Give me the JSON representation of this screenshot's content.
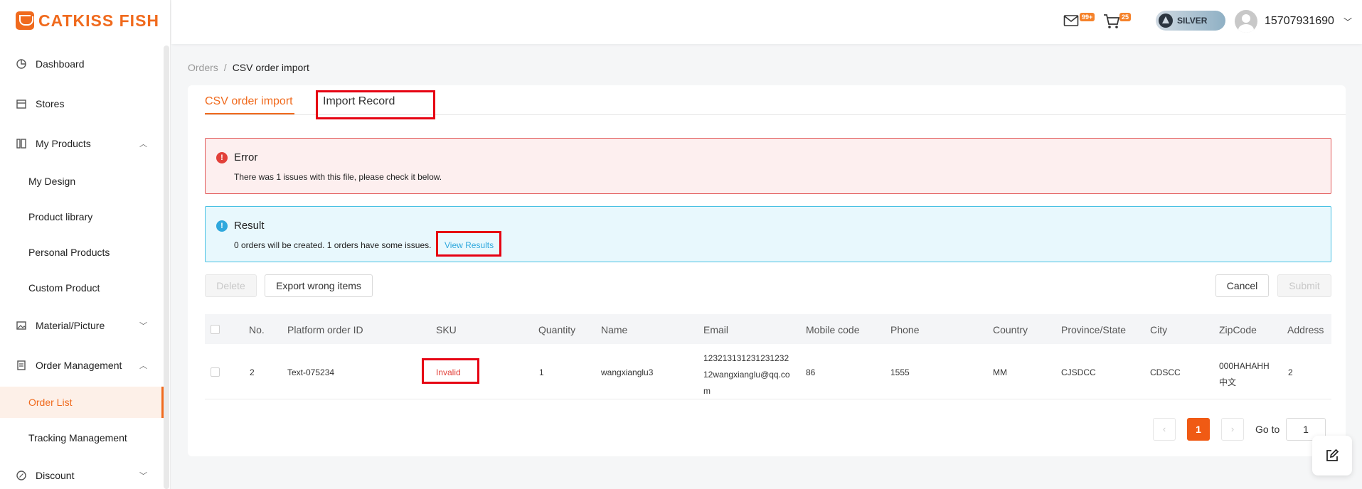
{
  "brand": {
    "name": "CATKISS FISH"
  },
  "sidebar": {
    "items": [
      {
        "label": "Dashboard",
        "icon": "pie-chart-icon"
      },
      {
        "label": "Stores",
        "icon": "store-icon"
      },
      {
        "label": "My Products",
        "icon": "products-icon",
        "expanded": true
      },
      {
        "label": "My Design"
      },
      {
        "label": "Product library"
      },
      {
        "label": "Personal Products"
      },
      {
        "label": "Custom Product"
      },
      {
        "label": "Material/Picture",
        "icon": "picture-icon",
        "expanded": false
      },
      {
        "label": "Order Management",
        "icon": "clipboard-icon",
        "expanded": true
      },
      {
        "label": "Order List",
        "active": true
      },
      {
        "label": "Tracking Management"
      },
      {
        "label": "Discount",
        "icon": "discount-icon",
        "expanded": false
      }
    ]
  },
  "header": {
    "mail_badge": "99+",
    "cart_badge": "25",
    "tier": "SILVER",
    "user": "15707931690"
  },
  "breadcrumb": {
    "parent": "Orders",
    "sep": "/",
    "current": "CSV order import"
  },
  "tabs": [
    {
      "label": "CSV order import",
      "active": true
    },
    {
      "label": "Import Record",
      "active": false
    }
  ],
  "error_alert": {
    "title": "Error",
    "message": "There was 1 issues with this file, please check it below."
  },
  "result_alert": {
    "title": "Result",
    "message": "0 orders will be created. 1 orders have some issues.",
    "link": "View Results"
  },
  "actions": {
    "delete": "Delete",
    "export": "Export wrong items",
    "cancel": "Cancel",
    "submit": "Submit"
  },
  "table": {
    "columns": [
      "No.",
      "Platform order ID",
      "SKU",
      "Quantity",
      "Name",
      "Email",
      "Mobile code",
      "Phone",
      "Country",
      "Province/State",
      "City",
      "ZipCode",
      "Address"
    ],
    "rows": [
      {
        "no": "2",
        "platform_order_id": "Text-075234",
        "sku": "Invalid",
        "quantity": "1",
        "name": "wangxianglu3",
        "email_lines": [
          "123213131231231232",
          "12wangxianglu@qq.co",
          "m"
        ],
        "mobile_code": "86",
        "phone": "1555",
        "country": "MM",
        "province": "CJSDCC",
        "city": "CDSCC",
        "zip_lines": [
          "000HAHAHH",
          "中文"
        ],
        "address": "2"
      }
    ]
  },
  "pagination": {
    "prev": "‹",
    "next": "›",
    "current_page": "1",
    "goto_label": "Go to",
    "goto_value": "1"
  },
  "colors": {
    "accent": "#f06a1d",
    "error": "#e2413a",
    "info": "#2fa8dd",
    "highlight_box": "#e60012"
  }
}
